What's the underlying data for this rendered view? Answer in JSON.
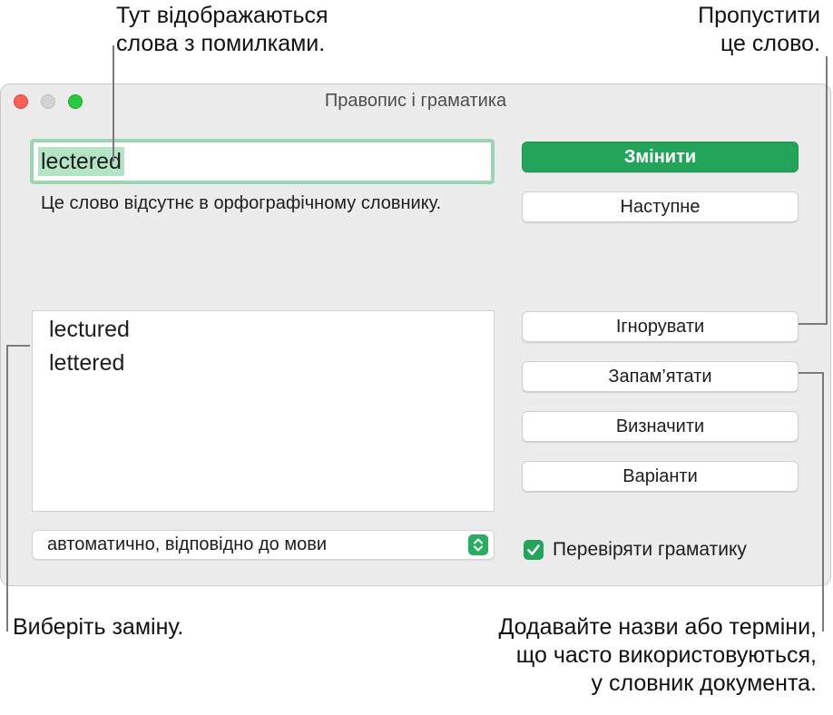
{
  "callouts": {
    "top_left": "Тут відображаються\nслова з помилками.",
    "top_right": "Пропустити\nце слово.",
    "bottom_left": "Виберіть заміну.",
    "bottom_right": "Додавайте назви або терміни,\nщо часто використовуються,\nу словник документа."
  },
  "window": {
    "title": "Правопис і граматика",
    "controls": [
      "close-icon",
      "minimize-icon",
      "zoom-icon"
    ]
  },
  "misspelled_word": "lectered",
  "message": "Це слово відсутнє в орфографічному словнику.",
  "suggestions": [
    "lectured",
    "lettered"
  ],
  "language_select": {
    "value": "автоматично, відповідно до мови",
    "icon": "up-down-chevron-icon"
  },
  "buttons": {
    "change": "Змінити",
    "next": "Наступне",
    "ignore": "Ігнорувати",
    "learn": "Запам’ятати",
    "define": "Визначити",
    "guess": "Варіанти"
  },
  "grammar_check": {
    "label": "Перевіряти граматику",
    "checked": true,
    "icon": "checkmark-icon"
  },
  "colors": {
    "accent": "#23a45a",
    "selection": "#b4e3c5",
    "close": "#fe5f57",
    "zoom": "#28c840"
  }
}
